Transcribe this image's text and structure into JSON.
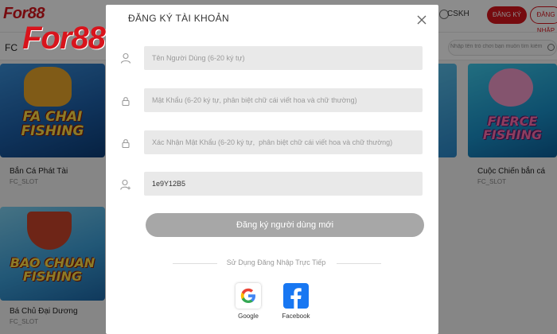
{
  "brand": {
    "logo": "For88",
    "accent": "#d8141c"
  },
  "header": {
    "support_label": "CSKH",
    "register_label": "ĐĂNG KÝ",
    "login_label": "ĐĂNG NHẬP"
  },
  "filter": {
    "provider_label": "FC",
    "search_placeholder": "Nhập tên trò chơi bạn muốn tìm kiếm"
  },
  "games": [
    {
      "title": "Bắn Cá Phát Tài",
      "provider": "FC_SLOT",
      "art_text": "FA CHAI FISHING"
    },
    {
      "title": "Cuộc Chiến bắn cá",
      "provider": "FC_SLOT",
      "art_text": "FIERCE FISHING"
    },
    {
      "title": "Bá Chủ Đại Dương",
      "provider": "FC_SLOT",
      "art_text": "BAO CHUAN FISHING"
    }
  ],
  "modal": {
    "title": "ĐĂNG KÝ TÀI KHOẢN",
    "fields": [
      {
        "icon": "user-icon",
        "placeholder": "Tên Người Dùng (6-20 ký tự)",
        "value": ""
      },
      {
        "icon": "lock-icon",
        "placeholder": "Mật Khẩu (6-20 ký tự, phân biệt chữ cái viết hoa và chữ thường)",
        "value": ""
      },
      {
        "icon": "lock-icon",
        "placeholder": "Xác Nhận Mật Khẩu (6-20 ký tự,  phân biệt chữ cái viết hoa và chữ thường)",
        "value": ""
      },
      {
        "icon": "add-user-icon",
        "placeholder": "",
        "value": "1e9Y12B5"
      }
    ],
    "submit_label": "Đăng ký người dùng mới",
    "divider_text": "Sử Dụng Đăng Nhập Trực Tiếp",
    "social": [
      {
        "icon": "google-icon",
        "label": "Google"
      },
      {
        "icon": "facebook-icon",
        "label": "Facebook"
      }
    ]
  }
}
